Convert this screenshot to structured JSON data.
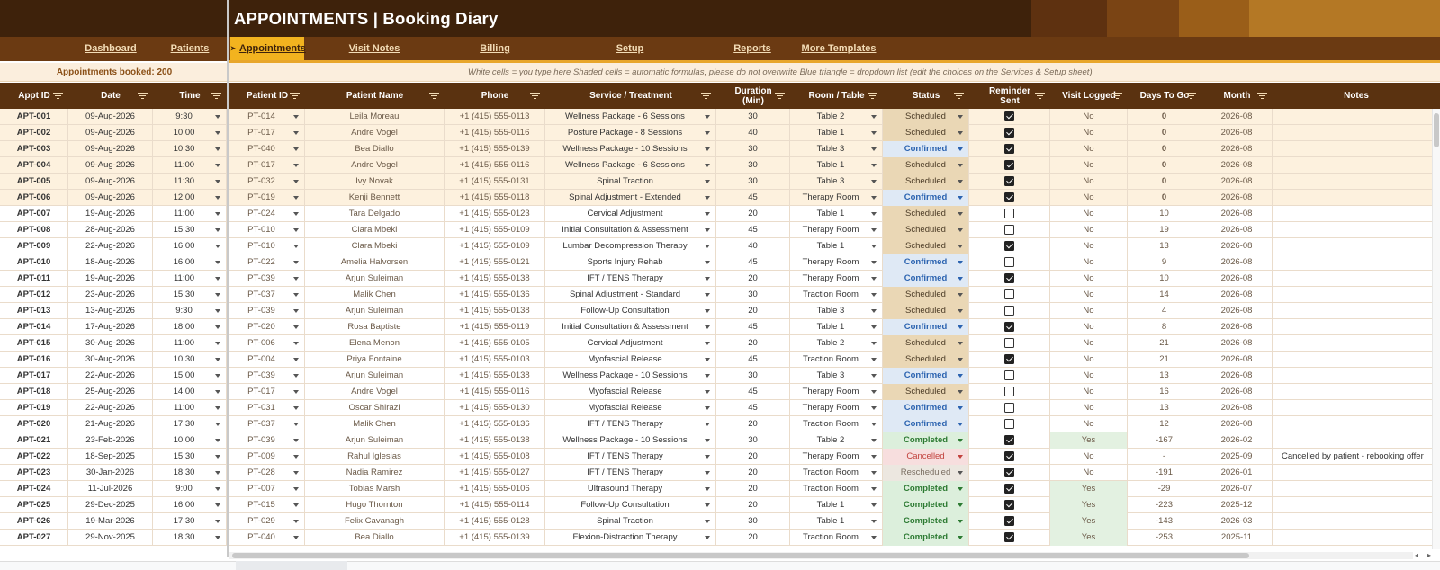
{
  "title": "APPOINTMENTS  |  Booking Diary",
  "nav": [
    {
      "label": "Dashboard",
      "active": false
    },
    {
      "label": "Patients",
      "active": false
    },
    {
      "label": "Appointments",
      "active": true,
      "marker": "➤"
    },
    {
      "label": "Visit Notes",
      "active": false
    },
    {
      "label": "Billing",
      "active": false
    },
    {
      "label": "Setup",
      "active": false
    },
    {
      "label": "Reports",
      "active": false
    },
    {
      "label": "More Templates",
      "active": false
    }
  ],
  "info": {
    "booked": "Appointments booked: 200",
    "legend": "White cells = you type here     Shaded cells = automatic formulas, please do not overwrite     Blue triangle = dropdown list (edit the choices on the Services & Setup sheet)"
  },
  "headers": [
    "Appt ID",
    "Date",
    "Time",
    "Patient ID",
    "Patient Name",
    "Phone",
    "Service / Treatment",
    "Duration (Min)",
    "Room / Table",
    "Status",
    "Reminder Sent",
    "Visit Logged",
    "Days To Go",
    "Month",
    "Notes"
  ],
  "colors": {
    "title_band": "#3e220b",
    "nav_band": "#6b3a12",
    "active_tab": "#f2b31f",
    "header_row": "#5a3210",
    "swatches": [
      "#5e3110",
      "#7a4414",
      "#9a5e19",
      "#b47825"
    ]
  },
  "rows": [
    {
      "id": "APT-001",
      "date": "09-Aug-2026",
      "time": "9:30",
      "pid": "PT-014",
      "name": "Leila Moreau",
      "phone": "+1 (415) 555-0113",
      "service": "Wellness Package - 6 Sessions",
      "dur": "30",
      "room": "Table 2",
      "status": "Scheduled",
      "reminder": true,
      "logged": "No",
      "days": "0",
      "month": "2026-08",
      "notes": ""
    },
    {
      "id": "APT-002",
      "date": "09-Aug-2026",
      "time": "10:00",
      "pid": "PT-017",
      "name": "Andre Vogel",
      "phone": "+1 (415) 555-0116",
      "service": "Posture Package - 8 Sessions",
      "dur": "40",
      "room": "Table 1",
      "status": "Scheduled",
      "reminder": true,
      "logged": "No",
      "days": "0",
      "month": "2026-08",
      "notes": ""
    },
    {
      "id": "APT-003",
      "date": "09-Aug-2026",
      "time": "10:30",
      "pid": "PT-040",
      "name": "Bea Diallo",
      "phone": "+1 (415) 555-0139",
      "service": "Wellness Package - 10 Sessions",
      "dur": "30",
      "room": "Table 3",
      "status": "Confirmed",
      "reminder": true,
      "logged": "No",
      "days": "0",
      "month": "2026-08",
      "notes": ""
    },
    {
      "id": "APT-004",
      "date": "09-Aug-2026",
      "time": "11:00",
      "pid": "PT-017",
      "name": "Andre Vogel",
      "phone": "+1 (415) 555-0116",
      "service": "Wellness Package - 6 Sessions",
      "dur": "30",
      "room": "Table 1",
      "status": "Scheduled",
      "reminder": true,
      "logged": "No",
      "days": "0",
      "month": "2026-08",
      "notes": ""
    },
    {
      "id": "APT-005",
      "date": "09-Aug-2026",
      "time": "11:30",
      "pid": "PT-032",
      "name": "Ivy Novak",
      "phone": "+1 (415) 555-0131",
      "service": "Spinal Traction",
      "dur": "30",
      "room": "Table 3",
      "status": "Scheduled",
      "reminder": true,
      "logged": "No",
      "days": "0",
      "month": "2026-08",
      "notes": ""
    },
    {
      "id": "APT-006",
      "date": "09-Aug-2026",
      "time": "12:00",
      "pid": "PT-019",
      "name": "Kenji Bennett",
      "phone": "+1 (415) 555-0118",
      "service": "Spinal Adjustment - Extended",
      "dur": "45",
      "room": "Therapy Room",
      "status": "Confirmed",
      "reminder": true,
      "logged": "No",
      "days": "0",
      "month": "2026-08",
      "notes": ""
    },
    {
      "id": "APT-007",
      "date": "19-Aug-2026",
      "time": "11:00",
      "pid": "PT-024",
      "name": "Tara Delgado",
      "phone": "+1 (415) 555-0123",
      "service": "Cervical Adjustment",
      "dur": "20",
      "room": "Table 1",
      "status": "Scheduled",
      "reminder": false,
      "logged": "No",
      "days": "10",
      "month": "2026-08",
      "notes": ""
    },
    {
      "id": "APT-008",
      "date": "28-Aug-2026",
      "time": "15:30",
      "pid": "PT-010",
      "name": "Clara Mbeki",
      "phone": "+1 (415) 555-0109",
      "service": "Initial Consultation & Assessment",
      "dur": "45",
      "room": "Therapy Room",
      "status": "Scheduled",
      "reminder": false,
      "logged": "No",
      "days": "19",
      "month": "2026-08",
      "notes": ""
    },
    {
      "id": "APT-009",
      "date": "22-Aug-2026",
      "time": "16:00",
      "pid": "PT-010",
      "name": "Clara Mbeki",
      "phone": "+1 (415) 555-0109",
      "service": "Lumbar Decompression Therapy",
      "dur": "40",
      "room": "Table 1",
      "status": "Scheduled",
      "reminder": true,
      "logged": "No",
      "days": "13",
      "month": "2026-08",
      "notes": ""
    },
    {
      "id": "APT-010",
      "date": "18-Aug-2026",
      "time": "16:00",
      "pid": "PT-022",
      "name": "Amelia Halvorsen",
      "phone": "+1 (415) 555-0121",
      "service": "Sports Injury Rehab",
      "dur": "45",
      "room": "Therapy Room",
      "status": "Confirmed",
      "reminder": false,
      "logged": "No",
      "days": "9",
      "month": "2026-08",
      "notes": ""
    },
    {
      "id": "APT-011",
      "date": "19-Aug-2026",
      "time": "11:00",
      "pid": "PT-039",
      "name": "Arjun Suleiman",
      "phone": "+1 (415) 555-0138",
      "service": "IFT / TENS Therapy",
      "dur": "20",
      "room": "Therapy Room",
      "status": "Confirmed",
      "reminder": true,
      "logged": "No",
      "days": "10",
      "month": "2026-08",
      "notes": ""
    },
    {
      "id": "APT-012",
      "date": "23-Aug-2026",
      "time": "15:30",
      "pid": "PT-037",
      "name": "Malik Chen",
      "phone": "+1 (415) 555-0136",
      "service": "Spinal Adjustment - Standard",
      "dur": "30",
      "room": "Traction Room",
      "status": "Scheduled",
      "reminder": false,
      "logged": "No",
      "days": "14",
      "month": "2026-08",
      "notes": ""
    },
    {
      "id": "APT-013",
      "date": "13-Aug-2026",
      "time": "9:30",
      "pid": "PT-039",
      "name": "Arjun Suleiman",
      "phone": "+1 (415) 555-0138",
      "service": "Follow-Up Consultation",
      "dur": "20",
      "room": "Table 3",
      "status": "Scheduled",
      "reminder": false,
      "logged": "No",
      "days": "4",
      "month": "2026-08",
      "notes": ""
    },
    {
      "id": "APT-014",
      "date": "17-Aug-2026",
      "time": "18:00",
      "pid": "PT-020",
      "name": "Rosa Baptiste",
      "phone": "+1 (415) 555-0119",
      "service": "Initial Consultation & Assessment",
      "dur": "45",
      "room": "Table 1",
      "status": "Confirmed",
      "reminder": true,
      "logged": "No",
      "days": "8",
      "month": "2026-08",
      "notes": ""
    },
    {
      "id": "APT-015",
      "date": "30-Aug-2026",
      "time": "11:00",
      "pid": "PT-006",
      "name": "Elena Menon",
      "phone": "+1 (415) 555-0105",
      "service": "Cervical Adjustment",
      "dur": "20",
      "room": "Table 2",
      "status": "Scheduled",
      "reminder": false,
      "logged": "No",
      "days": "21",
      "month": "2026-08",
      "notes": ""
    },
    {
      "id": "APT-016",
      "date": "30-Aug-2026",
      "time": "10:30",
      "pid": "PT-004",
      "name": "Priya Fontaine",
      "phone": "+1 (415) 555-0103",
      "service": "Myofascial Release",
      "dur": "45",
      "room": "Traction Room",
      "status": "Scheduled",
      "reminder": true,
      "logged": "No",
      "days": "21",
      "month": "2026-08",
      "notes": ""
    },
    {
      "id": "APT-017",
      "date": "22-Aug-2026",
      "time": "15:00",
      "pid": "PT-039",
      "name": "Arjun Suleiman",
      "phone": "+1 (415) 555-0138",
      "service": "Wellness Package - 10 Sessions",
      "dur": "30",
      "room": "Table 3",
      "status": "Confirmed",
      "reminder": false,
      "logged": "No",
      "days": "13",
      "month": "2026-08",
      "notes": ""
    },
    {
      "id": "APT-018",
      "date": "25-Aug-2026",
      "time": "14:00",
      "pid": "PT-017",
      "name": "Andre Vogel",
      "phone": "+1 (415) 555-0116",
      "service": "Myofascial Release",
      "dur": "45",
      "room": "Therapy Room",
      "status": "Scheduled",
      "reminder": false,
      "logged": "No",
      "days": "16",
      "month": "2026-08",
      "notes": ""
    },
    {
      "id": "APT-019",
      "date": "22-Aug-2026",
      "time": "11:00",
      "pid": "PT-031",
      "name": "Oscar Shirazi",
      "phone": "+1 (415) 555-0130",
      "service": "Myofascial Release",
      "dur": "45",
      "room": "Therapy Room",
      "status": "Confirmed",
      "reminder": false,
      "logged": "No",
      "days": "13",
      "month": "2026-08",
      "notes": ""
    },
    {
      "id": "APT-020",
      "date": "21-Aug-2026",
      "time": "17:30",
      "pid": "PT-037",
      "name": "Malik Chen",
      "phone": "+1 (415) 555-0136",
      "service": "IFT / TENS Therapy",
      "dur": "20",
      "room": "Traction Room",
      "status": "Confirmed",
      "reminder": false,
      "logged": "No",
      "days": "12",
      "month": "2026-08",
      "notes": ""
    },
    {
      "id": "APT-021",
      "date": "23-Feb-2026",
      "time": "10:00",
      "pid": "PT-039",
      "name": "Arjun Suleiman",
      "phone": "+1 (415) 555-0138",
      "service": "Wellness Package - 10 Sessions",
      "dur": "30",
      "room": "Table 2",
      "status": "Completed",
      "reminder": true,
      "logged": "Yes",
      "days": "-167",
      "month": "2026-02",
      "notes": ""
    },
    {
      "id": "APT-022",
      "date": "18-Sep-2025",
      "time": "15:30",
      "pid": "PT-009",
      "name": "Rahul Iglesias",
      "phone": "+1 (415) 555-0108",
      "service": "IFT / TENS Therapy",
      "dur": "20",
      "room": "Therapy Room",
      "status": "Cancelled",
      "reminder": true,
      "logged": "No",
      "days": "-",
      "month": "2025-09",
      "notes": "Cancelled by patient - rebooking offer"
    },
    {
      "id": "APT-023",
      "date": "30-Jan-2026",
      "time": "18:30",
      "pid": "PT-028",
      "name": "Nadia Ramirez",
      "phone": "+1 (415) 555-0127",
      "service": "IFT / TENS Therapy",
      "dur": "20",
      "room": "Traction Room",
      "status": "Rescheduled",
      "reminder": true,
      "logged": "No",
      "days": "-191",
      "month": "2026-01",
      "notes": ""
    },
    {
      "id": "APT-024",
      "date": "11-Jul-2026",
      "time": "9:00",
      "pid": "PT-007",
      "name": "Tobias Marsh",
      "phone": "+1 (415) 555-0106",
      "service": "Ultrasound Therapy",
      "dur": "20",
      "room": "Traction Room",
      "status": "Completed",
      "reminder": true,
      "logged": "Yes",
      "days": "-29",
      "month": "2026-07",
      "notes": ""
    },
    {
      "id": "APT-025",
      "date": "29-Dec-2025",
      "time": "16:00",
      "pid": "PT-015",
      "name": "Hugo Thornton",
      "phone": "+1 (415) 555-0114",
      "service": "Follow-Up Consultation",
      "dur": "20",
      "room": "Table 1",
      "status": "Completed",
      "reminder": true,
      "logged": "Yes",
      "days": "-223",
      "month": "2025-12",
      "notes": ""
    },
    {
      "id": "APT-026",
      "date": "19-Mar-2026",
      "time": "17:30",
      "pid": "PT-029",
      "name": "Felix Cavanagh",
      "phone": "+1 (415) 555-0128",
      "service": "Spinal Traction",
      "dur": "30",
      "room": "Table 1",
      "status": "Completed",
      "reminder": true,
      "logged": "Yes",
      "days": "-143",
      "month": "2026-03",
      "notes": ""
    },
    {
      "id": "APT-027",
      "date": "29-Nov-2025",
      "time": "18:30",
      "pid": "PT-040",
      "name": "Bea Diallo",
      "phone": "+1 (415) 555-0139",
      "service": "Flexion-Distraction Therapy",
      "dur": "20",
      "room": "Traction Room",
      "status": "Completed",
      "reminder": true,
      "logged": "Yes",
      "days": "-253",
      "month": "2025-11",
      "notes": ""
    }
  ]
}
